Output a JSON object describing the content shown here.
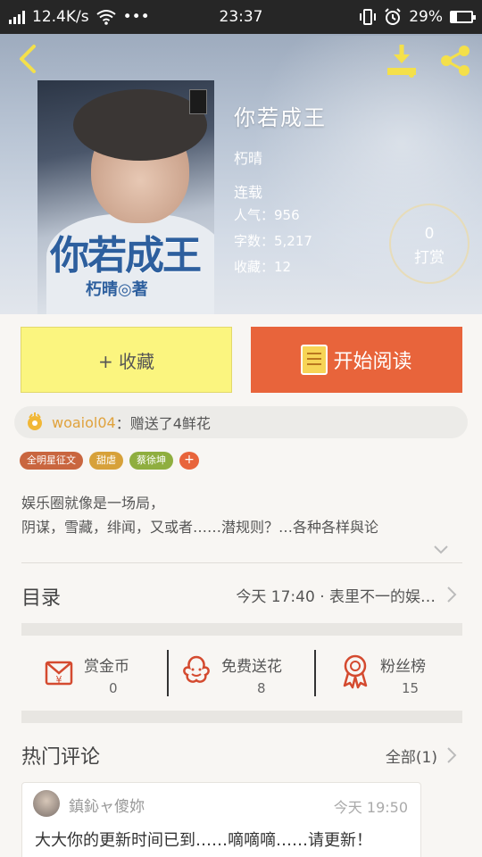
{
  "status_bar": {
    "speed": "12.4K/s",
    "dots": "•••",
    "time": "23:37",
    "battery_percent": "29%",
    "battery_level": 0.29
  },
  "book": {
    "cover_title": "你若成王",
    "cover_author": "朽晴◎著",
    "title": "你若成王",
    "author": "朽晴",
    "status": "连载",
    "popularity": "人气：956",
    "word_count": "字数：5,217",
    "favorites": "收藏：12",
    "tip_count": "0",
    "tip_label": "打赏"
  },
  "actions": {
    "favorite_label": "+ 收藏",
    "read_label": "开始阅读"
  },
  "gift_feed": {
    "user": "woaiol04",
    "text": "：赠送了4鲜花"
  },
  "tags": [
    {
      "label": "全明星征文",
      "color": "#c9663f"
    },
    {
      "label": "甜虐",
      "color": "#d7a13a"
    },
    {
      "label": "蔡徐坤",
      "color": "#8fae3f"
    }
  ],
  "add_tag_label": "+",
  "description": {
    "line1": "娱乐圈就像是一场局，",
    "line2": "阴谋，雪藏，绯闻，又或者……潜规则？…各种各样與论"
  },
  "toc": {
    "label": "目录",
    "latest": "今天 17:40 · 表里不一的娱…"
  },
  "stats": [
    {
      "label": "赏金币",
      "value": "0",
      "icon": "coin-envelope-icon"
    },
    {
      "label": "免费送花",
      "value": "8",
      "icon": "flower-icon"
    },
    {
      "label": "粉丝榜",
      "value": "15",
      "icon": "medal-icon"
    }
  ],
  "comments_section": {
    "title": "热门评论",
    "all_label": "全部(1)"
  },
  "comment": {
    "user": "鎮鈊ャ傻妳",
    "time": "今天 19:50",
    "text": "大大你的更新时间已到……嘀嘀嘀……请更新！"
  },
  "colors": {
    "accent_orange": "#e8643b",
    "favorite_yellow": "#fbf57f",
    "icon_yellow": "#f4e04a",
    "icon_red": "#d44a2f"
  }
}
